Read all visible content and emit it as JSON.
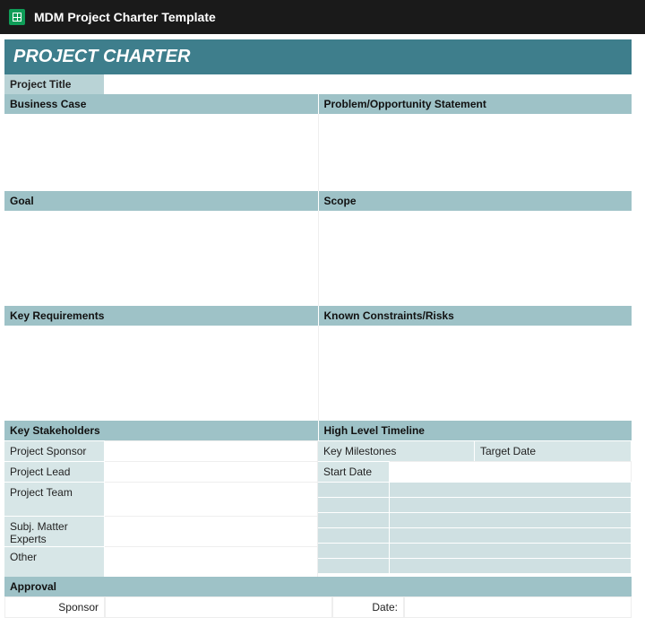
{
  "header": {
    "doc_title": "MDM Project Charter Template"
  },
  "charter": {
    "banner": "PROJECT CHARTER",
    "project_title_label": "Project Title",
    "project_title_value": "",
    "sections": {
      "business_case": "Business Case",
      "problem_statement": "Problem/Opportunity Statement",
      "goal": "Goal",
      "scope": "Scope",
      "key_requirements": "Key Requirements",
      "known_constraints": "Known Constraints/Risks",
      "key_stakeholders": "Key Stakeholders",
      "high_level_timeline": "High Level Timeline"
    },
    "stakeholders": {
      "project_sponsor": "Project Sponsor",
      "project_lead": "Project Lead",
      "project_team": "Project Team",
      "sme": "Subj. Matter Experts",
      "other": "Other"
    },
    "timeline": {
      "key_milestones": "Key Milestones",
      "target_date": "Target Date",
      "start_date": "Start Date"
    },
    "approval": {
      "label": "Approval",
      "sponsor_label": "Sponsor",
      "date_label": "Date:"
    }
  }
}
